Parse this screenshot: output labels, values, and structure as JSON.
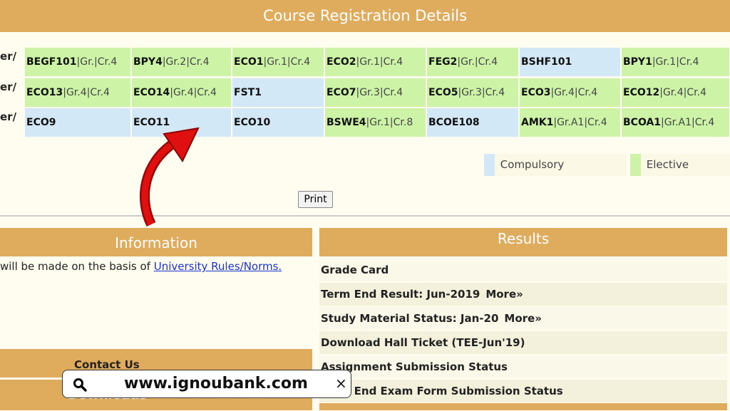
{
  "header": {
    "title": "Course Registration Details"
  },
  "rows": [
    {
      "label": "er/",
      "cells": [
        {
          "code": "BEGF101",
          "meta": "|Gr.|Cr.4",
          "type": "elective"
        },
        {
          "code": "BPY4",
          "meta": "|Gr.2|Cr.4",
          "type": "elective"
        },
        {
          "code": "ECO1",
          "meta": "|Gr.1|Cr.4",
          "type": "elective"
        },
        {
          "code": "ECO2",
          "meta": "|Gr.1|Cr.4",
          "type": "elective"
        },
        {
          "code": "FEG2",
          "meta": "|Gr.|Cr.4",
          "type": "elective"
        },
        {
          "code": "BSHF101",
          "meta": "",
          "type": "compulsory"
        },
        {
          "code": "BPY1",
          "meta": "|Gr.1|Cr.4",
          "type": "elective"
        }
      ]
    },
    {
      "label": "er/",
      "cells": [
        {
          "code": "ECO13",
          "meta": "|Gr.4|Cr.4",
          "type": "elective"
        },
        {
          "code": "ECO14",
          "meta": "|Gr.4|Cr.4",
          "type": "elective"
        },
        {
          "code": "FST1",
          "meta": "",
          "type": "compulsory"
        },
        {
          "code": "ECO7",
          "meta": "|Gr.3|Cr.4",
          "type": "elective"
        },
        {
          "code": "ECO5",
          "meta": "|Gr.3|Cr.4",
          "type": "elective"
        },
        {
          "code": "ECO3",
          "meta": "|Gr.4|Cr.4",
          "type": "elective"
        },
        {
          "code": "ECO12",
          "meta": "|Gr.4|Cr.4",
          "type": "elective"
        }
      ]
    },
    {
      "label": "er/",
      "cells": [
        {
          "code": "ECO9",
          "meta": "",
          "type": "compulsory"
        },
        {
          "code": "ECO11",
          "meta": "",
          "type": "compulsory"
        },
        {
          "code": "ECO10",
          "meta": "",
          "type": "compulsory"
        },
        {
          "code": "BSWE4",
          "meta": "|Gr.1|Cr.8",
          "type": "elective"
        },
        {
          "code": "BCOE108",
          "meta": "",
          "type": "compulsory"
        },
        {
          "code": "AMK1",
          "meta": "|Gr.A1|Cr.4",
          "type": "elective"
        },
        {
          "code": "BCOA1",
          "meta": "|Gr.A1|Cr.4",
          "type": "elective"
        }
      ]
    }
  ],
  "legend": {
    "compulsory": "Compulsory",
    "elective": "Elective",
    "compulsory_color": "#d3e8f6",
    "elective_color": "#ccf3a6"
  },
  "print_label": "Print",
  "information": {
    "title": "Information",
    "text": "will be made on the basis of ",
    "link": "University Rules/Norms."
  },
  "contact": "Contact Us",
  "downloads": "Downloads",
  "results": {
    "title": "Results",
    "items": [
      {
        "text": "Grade Card",
        "more": ""
      },
      {
        "text": "Term End Result: Jun-2019",
        "more": "More»"
      },
      {
        "text": "Study Material Status: Jan-20",
        "more": "More»"
      },
      {
        "text": "Download Hall Ticket (TEE-Jun'19)",
        "more": ""
      },
      {
        "text": "Assignment Submission Status",
        "more": ""
      },
      {
        "text": "Term End Exam Form Submission Status",
        "more": ""
      }
    ]
  },
  "watermark": {
    "url": "www.ignoubank.com"
  }
}
